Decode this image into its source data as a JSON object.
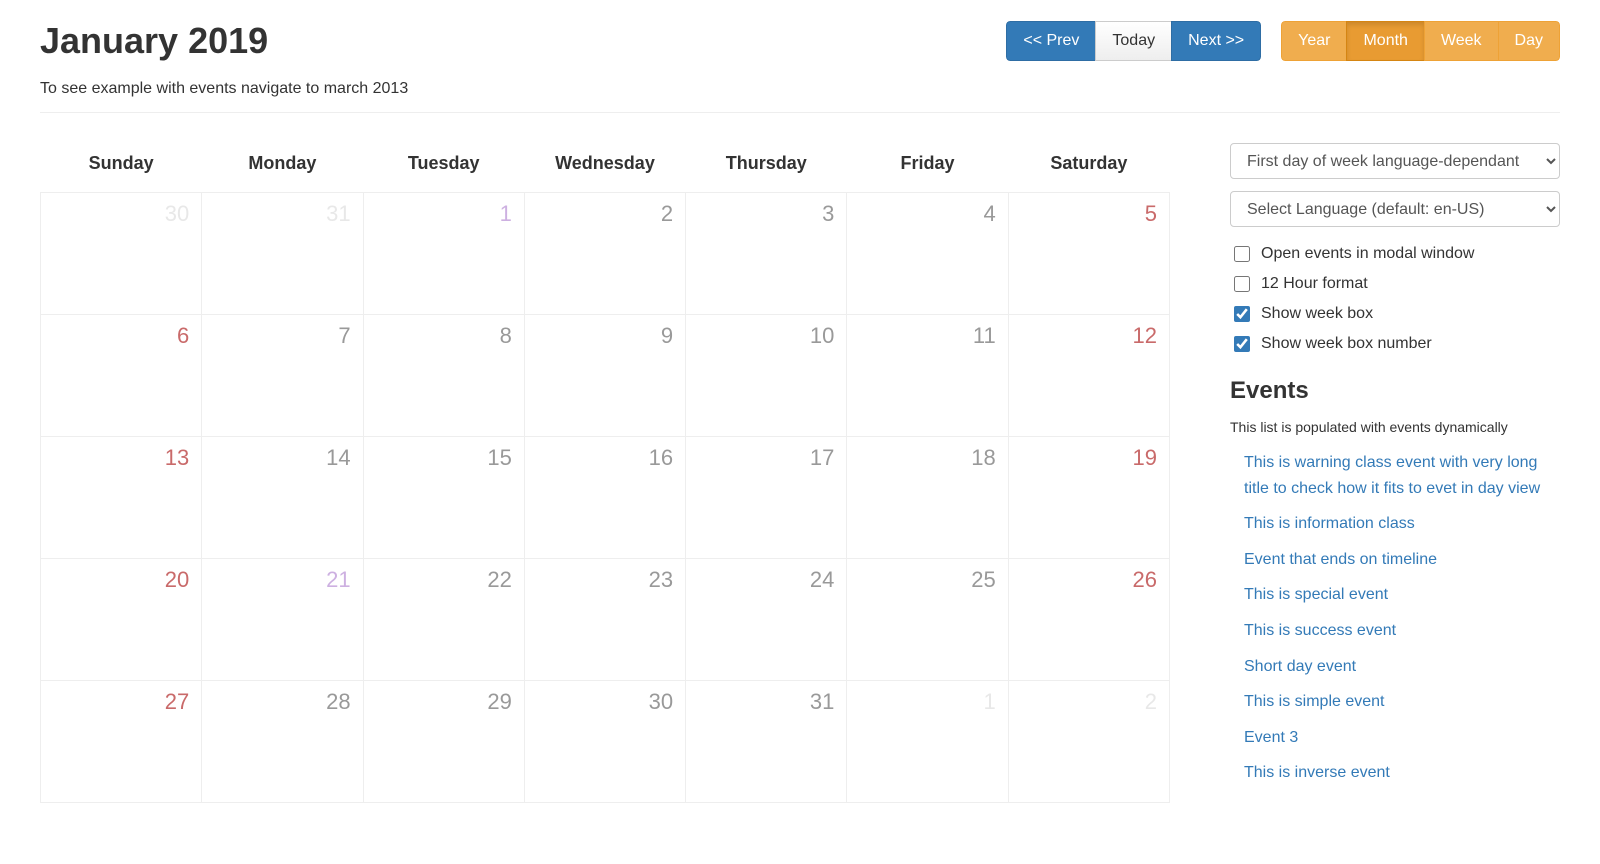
{
  "header": {
    "title": "January 2019",
    "nav": {
      "prev": "<< Prev",
      "today": "Today",
      "next": "Next >>"
    },
    "views": {
      "year": "Year",
      "month": "Month",
      "week": "Week",
      "day": "Day",
      "active": "month"
    }
  },
  "subtitle": "To see example with events navigate to march 2013",
  "calendar": {
    "day_headers": [
      "Sunday",
      "Monday",
      "Tuesday",
      "Wednesday",
      "Thursday",
      "Friday",
      "Saturday"
    ],
    "weeks": [
      [
        {
          "n": "30",
          "cls": "faded"
        },
        {
          "n": "31",
          "cls": "faded"
        },
        {
          "n": "1",
          "cls": "purple"
        },
        {
          "n": "2",
          "cls": "grey"
        },
        {
          "n": "3",
          "cls": "grey"
        },
        {
          "n": "4",
          "cls": "grey"
        },
        {
          "n": "5",
          "cls": "red"
        }
      ],
      [
        {
          "n": "6",
          "cls": "red"
        },
        {
          "n": "7",
          "cls": "grey"
        },
        {
          "n": "8",
          "cls": "grey"
        },
        {
          "n": "9",
          "cls": "grey"
        },
        {
          "n": "10",
          "cls": "grey"
        },
        {
          "n": "11",
          "cls": "grey"
        },
        {
          "n": "12",
          "cls": "red"
        }
      ],
      [
        {
          "n": "13",
          "cls": "red"
        },
        {
          "n": "14",
          "cls": "grey"
        },
        {
          "n": "15",
          "cls": "grey"
        },
        {
          "n": "16",
          "cls": "grey"
        },
        {
          "n": "17",
          "cls": "grey"
        },
        {
          "n": "18",
          "cls": "grey"
        },
        {
          "n": "19",
          "cls": "red"
        }
      ],
      [
        {
          "n": "20",
          "cls": "red"
        },
        {
          "n": "21",
          "cls": "purple"
        },
        {
          "n": "22",
          "cls": "grey"
        },
        {
          "n": "23",
          "cls": "grey"
        },
        {
          "n": "24",
          "cls": "grey"
        },
        {
          "n": "25",
          "cls": "grey"
        },
        {
          "n": "26",
          "cls": "red"
        }
      ],
      [
        {
          "n": "27",
          "cls": "red"
        },
        {
          "n": "28",
          "cls": "grey"
        },
        {
          "n": "29",
          "cls": "grey"
        },
        {
          "n": "30",
          "cls": "grey"
        },
        {
          "n": "31",
          "cls": "grey"
        },
        {
          "n": "1",
          "cls": "faded"
        },
        {
          "n": "2",
          "cls": "faded"
        }
      ]
    ]
  },
  "sidebar": {
    "first_day_select": "First day of week language-dependant",
    "language_select": "Select Language (default: en-US)",
    "options": [
      {
        "label": "Open events in modal window",
        "checked": false
      },
      {
        "label": "12 Hour format",
        "checked": false
      },
      {
        "label": "Show week box",
        "checked": true
      },
      {
        "label": "Show week box number",
        "checked": true
      }
    ],
    "events_heading": "Events",
    "events_note": "This list is populated with events dynamically",
    "events": [
      "This is warning class event with very long title to check how it fits to evet in day view",
      "This is information class",
      "Event that ends on timeline",
      "This is special event",
      "This is success event",
      "Short day event",
      "This is simple event",
      "Event 3",
      "This is inverse event"
    ]
  }
}
